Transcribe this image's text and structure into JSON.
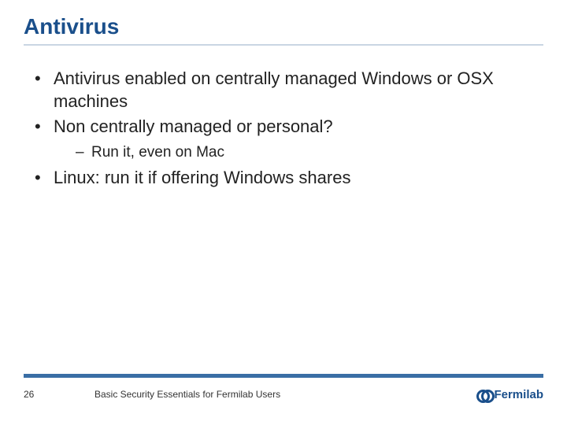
{
  "title": "Antivirus",
  "bullets": {
    "b1": "Antivirus enabled on centrally managed Windows or OSX machines",
    "b2": "Non centrally managed or personal?",
    "b2_sub1": "Run it, even on Mac",
    "b3": "Linux: run it if offering Windows shares"
  },
  "footer": {
    "page": "26",
    "title": "Basic Security Essentials for Fermilab Users",
    "logo_text": "Fermilab"
  }
}
